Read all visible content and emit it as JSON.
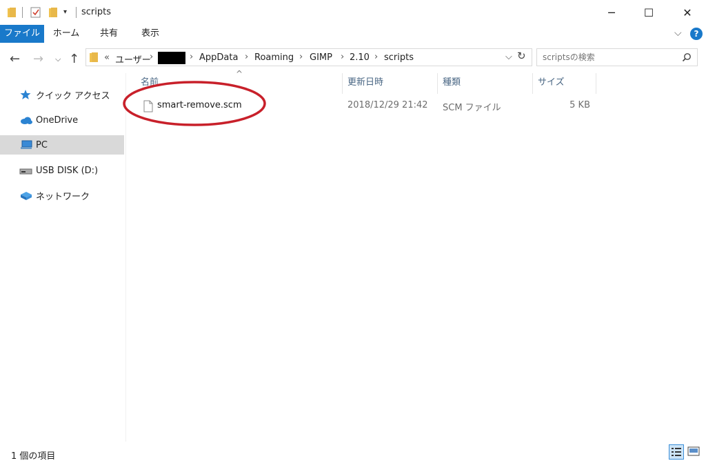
{
  "window": {
    "title": "scripts",
    "minimize_glyph": "─",
    "maximize_glyph": "☐",
    "close_glyph": "✕"
  },
  "ribbon": {
    "tabs": [
      "ファイル",
      "ホーム",
      "共有",
      "表示"
    ],
    "expand_glyph": "⌵",
    "help_glyph": "?"
  },
  "address": {
    "overflow_glyph": "«",
    "breadcrumbs": [
      "ユーザー",
      "AppData",
      "Roaming",
      "GIMP",
      "2.10",
      "scripts"
    ],
    "separator": "›",
    "dropdown_glyph": "⌵",
    "refresh_glyph": "↻"
  },
  "search": {
    "placeholder": "scriptsの検索"
  },
  "nav": {
    "back_glyph": "←",
    "forward_glyph": "→",
    "recent_glyph": "⌵",
    "up_glyph": "↑"
  },
  "sidebar": {
    "items": [
      {
        "label": "クイック アクセス",
        "icon": "star-icon"
      },
      {
        "label": "OneDrive",
        "icon": "cloud-icon"
      },
      {
        "label": "PC",
        "icon": "computer-icon"
      },
      {
        "label": "USB DISK (D:)",
        "icon": "usb-drive-icon"
      },
      {
        "label": "ネットワーク",
        "icon": "network-icon"
      }
    ]
  },
  "columns": {
    "name": "名前",
    "modified": "更新日時",
    "type": "種類",
    "size": "サイズ",
    "sort_glyph": "^"
  },
  "files": [
    {
      "name": "smart-remove.scm",
      "modified": "2018/12/29 21:42",
      "type": "SCM ファイル",
      "size": "5 KB"
    }
  ],
  "status": {
    "item_count": "1 個の項目"
  },
  "colors": {
    "accent": "#1979ca",
    "selection": "#d9d9d9",
    "annotation_circle": "#c8202a",
    "folder": "#e8b84a"
  }
}
